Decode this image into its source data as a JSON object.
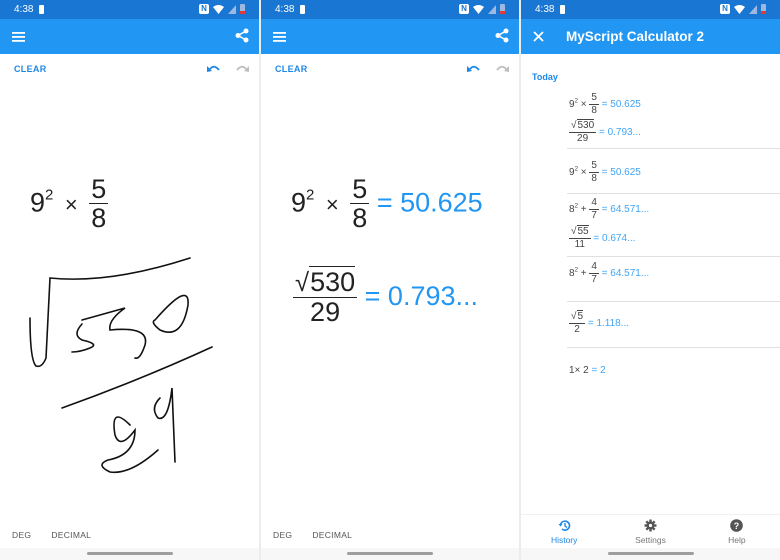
{
  "status_bar": {
    "time": "4:38"
  },
  "screens": [
    {
      "toolbar": {
        "clear_label": "CLEAR"
      },
      "expression_typed": {
        "base": "9",
        "exponent": "2",
        "operator": "×",
        "numerator": "5",
        "denominator": "8"
      },
      "handwriting": {
        "recognized_as": "√530 / 29"
      },
      "modes": {
        "angle": "DEG",
        "format": "DECIMAL"
      }
    },
    {
      "toolbar": {
        "clear_label": "CLEAR"
      },
      "expr1": {
        "base": "9",
        "exponent": "2",
        "operator": "×",
        "numerator": "5",
        "denominator": "8",
        "result": "= 50.625"
      },
      "expr2": {
        "radicand": "530",
        "denominator": "29",
        "result": "= 0.793..."
      },
      "modes": {
        "angle": "DEG",
        "format": "DECIMAL"
      }
    },
    {
      "title": "MyScript Calculator 2",
      "section": "Today",
      "history": [
        {
          "type": "power-frac",
          "base": "9",
          "exp": "2",
          "op": "×",
          "num": "5",
          "den": "8",
          "result": "= 50.625"
        },
        {
          "type": "sqrt-frac",
          "radicand": "530",
          "den": "29",
          "result": "= 0.793..."
        },
        {
          "type": "power-frac",
          "base": "9",
          "exp": "2",
          "op": "×",
          "num": "5",
          "den": "8",
          "result": "= 50.625"
        },
        {
          "type": "power-frac",
          "base": "8",
          "exp": "2",
          "op": "+",
          "num": "4",
          "den": "7",
          "result": "= 64.571..."
        },
        {
          "type": "sqrt-frac",
          "radicand": "55",
          "den": "11",
          "result": "= 0.674..."
        },
        {
          "type": "power-frac",
          "base": "8",
          "exp": "2",
          "op": "+",
          "num": "4",
          "den": "7",
          "result": "= 64.571..."
        },
        {
          "type": "sqrt-frac",
          "radicand": "5",
          "den": "2",
          "result": "= 1.118..."
        },
        {
          "type": "simple",
          "expr": "1× 2",
          "result": "= 2"
        }
      ],
      "tabs": [
        {
          "label": "History",
          "icon": "history-icon",
          "active": true
        },
        {
          "label": "Settings",
          "icon": "gear-icon",
          "active": false
        },
        {
          "label": "Help",
          "icon": "help-icon",
          "active": false
        }
      ]
    }
  ],
  "colors": {
    "status_bar": "#1976d2",
    "app_bar": "#2196f3",
    "accent": "#1e88e5",
    "result": "#2196f3"
  }
}
